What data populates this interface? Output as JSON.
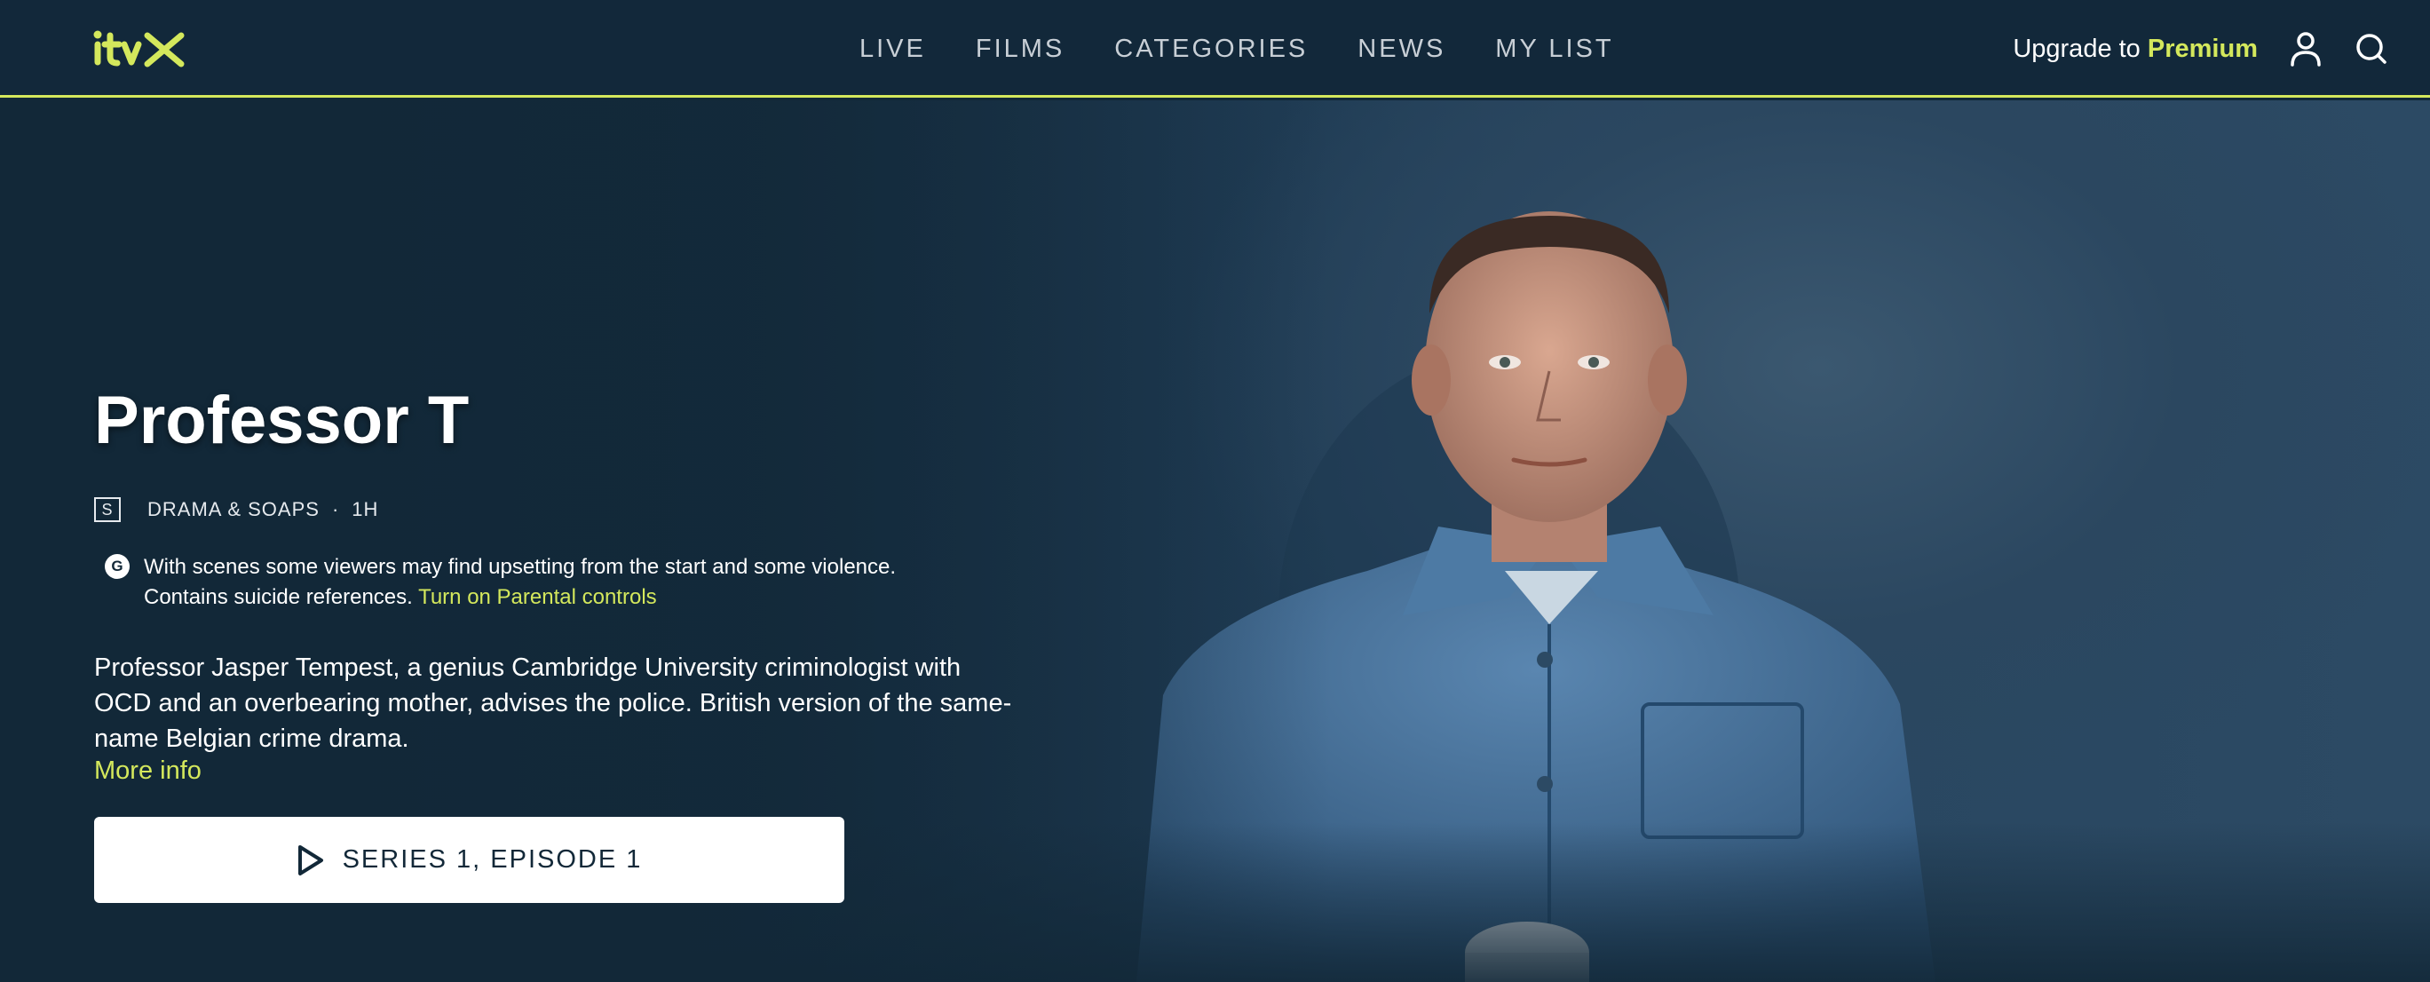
{
  "header": {
    "logo_text": "itvX",
    "nav": [
      "LIVE",
      "FILMS",
      "CATEGORIES",
      "NEWS",
      "MY LIST"
    ],
    "upgrade_prefix": "Upgrade to",
    "upgrade_highlight": "Premium",
    "profile_icon": "user-icon",
    "search_icon": "search-icon"
  },
  "hero": {
    "title": "Professor T",
    "rating_badge": "S",
    "genre": "DRAMA & SOAPS",
    "separator": "·",
    "duration": "1H",
    "guidance_badge": "G",
    "guidance_line1": "With scenes some viewers may find upsetting from the start and some violence.",
    "guidance_line2": "Contains suicide references.",
    "parental_link": "Turn on Parental controls",
    "synopsis": "Professor Jasper Tempest, a genius Cambridge University criminologist with OCD and an overbearing mother, advises the police. British version of the same-name Belgian crime drama.",
    "more_info": "More info",
    "play_label": "SERIES 1, EPISODE 1"
  },
  "colors": {
    "background": "#122838",
    "accent": "#d4e85c",
    "button_bg": "#ffffff"
  }
}
